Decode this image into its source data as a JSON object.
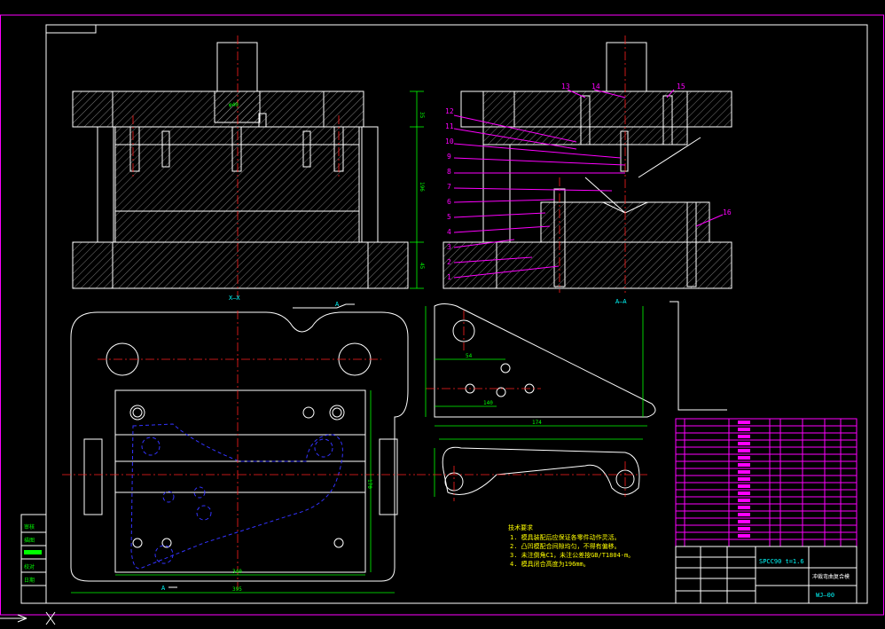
{
  "colors": {
    "background": "#000000",
    "outline": "#ffffff",
    "dimension": "#00ff00",
    "centerline": "#ff2020",
    "border": "#ff00ff",
    "hidden": "#3333ff",
    "note": "#ffff00",
    "title": "#00ffff"
  },
  "views": {
    "front_label": "X—X",
    "side_label": "A—A",
    "section_marker": "A"
  },
  "part_numbers": [
    "13",
    "14",
    "15",
    "12",
    "11",
    "10",
    "9",
    "8",
    "7",
    "6",
    "5",
    "4",
    "3",
    "2",
    "1",
    "16"
  ],
  "dimensions": {
    "overall_height": "196",
    "top_height": "35",
    "bottom_height": "45",
    "plan_width": "340",
    "plan_total": "395",
    "plan_height": "170",
    "shank_dia": "φ40",
    "part_width": "174",
    "part_inner": "140",
    "part_short": "54"
  },
  "title_block": {
    "material": "SPCC90  t=1.6",
    "drawing_title": "冲裁弯曲复合模",
    "drawing_no": "WJ—00"
  },
  "notes": {
    "heading": "技术要求",
    "lines": [
      "1. 模具装配后应保证各零件动作灵活。",
      "2. 凸凹模配合间隙均匀，不得有偏移。",
      "3. 未注倒角C1，未注公差按GB/T1804-m。",
      "4. 模具闭合高度为196mm。"
    ]
  },
  "left_strip": [
    "审核",
    "描图",
    "校对",
    "日期"
  ]
}
